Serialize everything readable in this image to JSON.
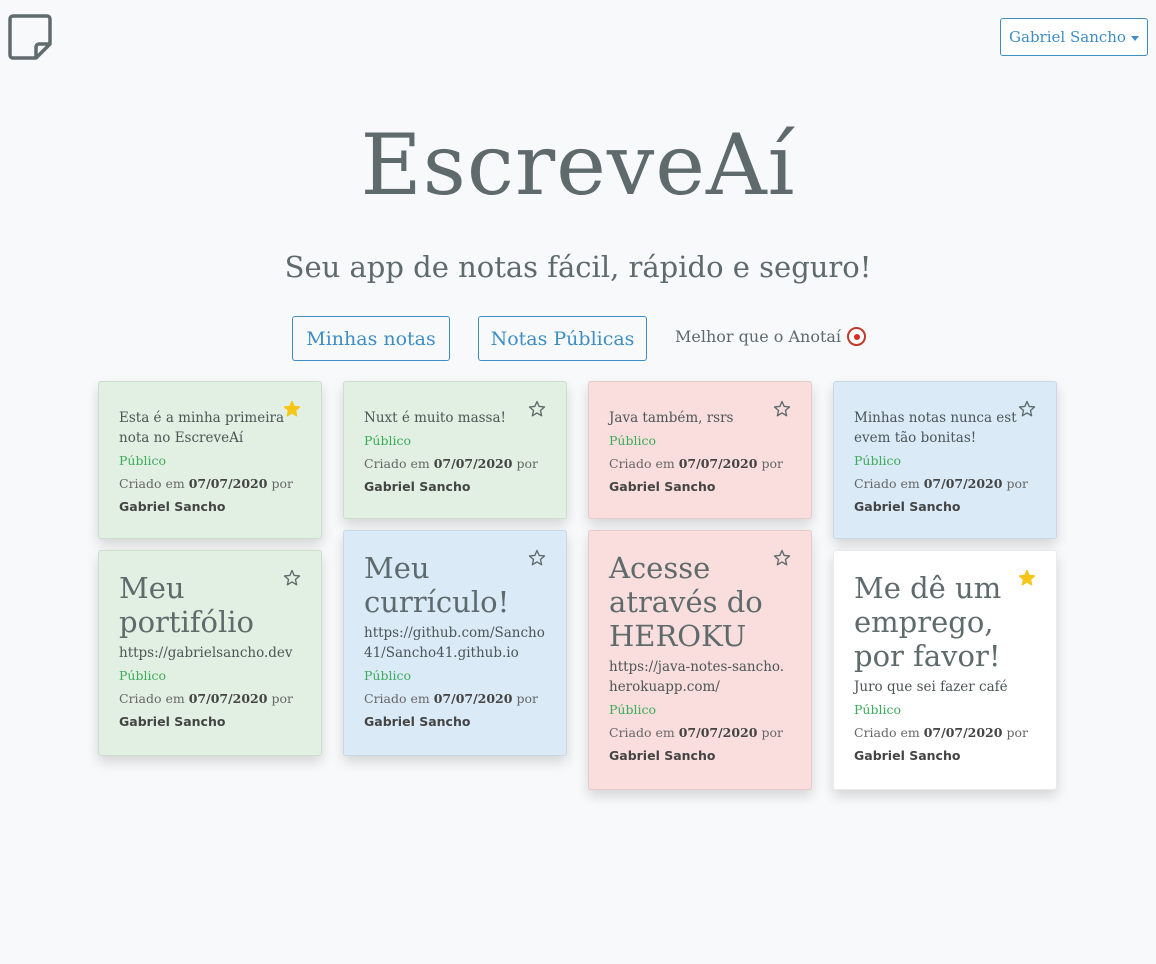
{
  "header": {
    "logo_icon": "sticky-note-icon",
    "user_menu_label": "Gabriel Sancho"
  },
  "hero": {
    "title": "EscreveAí",
    "subtitle": "Seu app de notas fácil, rápido e seguro!"
  },
  "nav": {
    "my_notes_label": "Minhas notas",
    "public_notes_label": "Notas Públicas",
    "tagline": "Melhor que o Anotaí",
    "tagline_icon": "clown-face-icon"
  },
  "colors": {
    "accent": "#3e8ec4",
    "public_green": "#3cab5a",
    "star_filled": "#f5c518",
    "card_green": "#e1f0e2",
    "card_blue": "#daeaf7",
    "card_red": "#f9dedd",
    "card_white": "#ffffff"
  },
  "notes": [
    {
      "color": "green",
      "title": "",
      "text": "Esta é a minha primeira nota no EscreveAí",
      "visibility": "Público",
      "created_prefix": "Criado em",
      "date": "07/07/2020",
      "by": "por",
      "author": "Gabriel Sancho",
      "starred": true
    },
    {
      "color": "green",
      "title": "",
      "text": "Nuxt é muito massa!",
      "visibility": "Público",
      "created_prefix": "Criado em",
      "date": "07/07/2020",
      "by": "por",
      "author": "Gabriel Sancho",
      "starred": false
    },
    {
      "color": "red",
      "title": "",
      "text": "Java também, rsrs",
      "visibility": "Público",
      "created_prefix": "Criado em",
      "date": "07/07/2020",
      "by": "por",
      "author": "Gabriel Sancho",
      "starred": false
    },
    {
      "color": "blue",
      "title": "",
      "text": "Minhas notas nunca estevem tão bonitas!",
      "visibility": "Público",
      "created_prefix": "Criado em",
      "date": "07/07/2020",
      "by": "por",
      "author": "Gabriel Sancho",
      "starred": false
    },
    {
      "color": "green",
      "title": "Meu portifólio",
      "text": "https://gabrielsancho.dev",
      "visibility": "Público",
      "created_prefix": "Criado em",
      "date": "07/07/2020",
      "by": "por",
      "author": "Gabriel Sancho",
      "starred": false
    },
    {
      "color": "blue",
      "title": "Meu currículo!",
      "text": "https://github.com/Sancho41/Sancho41.github.io",
      "visibility": "Público",
      "created_prefix": "Criado em",
      "date": "07/07/2020",
      "by": "por",
      "author": "Gabriel Sancho",
      "starred": false
    },
    {
      "color": "red",
      "title": "Acesse através do HEROKU",
      "text": "https://java-notes-sancho.herokuapp.com/",
      "visibility": "Público",
      "created_prefix": "Criado em",
      "date": "07/07/2020",
      "by": "por",
      "author": "Gabriel Sancho",
      "starred": false
    },
    {
      "color": "white",
      "title": "Me dê um emprego, por favor!",
      "text": "Juro que sei fazer café",
      "visibility": "Público",
      "created_prefix": "Criado em",
      "date": "07/07/2020",
      "by": "por",
      "author": "Gabriel Sancho",
      "starred": true
    }
  ]
}
